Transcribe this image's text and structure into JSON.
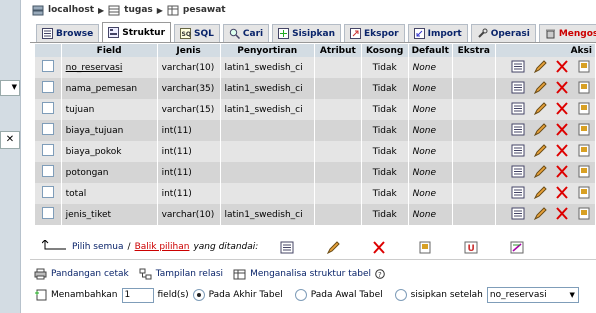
{
  "breadcrumb": {
    "server": "localhost",
    "database": "tugas",
    "table": "pesawat"
  },
  "tabs": [
    {
      "label": "Browse",
      "icon": "browse-icon",
      "active": false
    },
    {
      "label": "Struktur",
      "icon": "structure-icon",
      "active": true
    },
    {
      "label": "SQL",
      "icon": "sql-icon",
      "active": false
    },
    {
      "label": "Cari",
      "icon": "search-icon",
      "active": false
    },
    {
      "label": "Sisipkan",
      "icon": "insert-icon",
      "active": false
    },
    {
      "label": "Ekspor",
      "icon": "export-icon",
      "active": false
    },
    {
      "label": "Import",
      "icon": "import-icon",
      "active": false
    },
    {
      "label": "Operasi",
      "icon": "operations-icon",
      "active": false
    },
    {
      "label": "Mengoso",
      "icon": "empty-icon",
      "active": false
    }
  ],
  "columns": [
    "Field",
    "Jenis",
    "Penyortiran",
    "Atribut",
    "Kosong",
    "Default",
    "Ekstra",
    "Aksi"
  ],
  "rows": [
    {
      "field": "no_reservasi",
      "type": "varchar(10)",
      "collation": "latin1_swedish_ci",
      "attr": "",
      "null": "Tidak",
      "default": "None",
      "extra": "",
      "pk": true
    },
    {
      "field": "nama_pemesan",
      "type": "varchar(35)",
      "collation": "latin1_swedish_ci",
      "attr": "",
      "null": "Tidak",
      "default": "None",
      "extra": "",
      "pk": false
    },
    {
      "field": "tujuan",
      "type": "varchar(15)",
      "collation": "latin1_swedish_ci",
      "attr": "",
      "null": "Tidak",
      "default": "None",
      "extra": "",
      "pk": false
    },
    {
      "field": "biaya_tujuan",
      "type": "int(11)",
      "collation": "",
      "attr": "",
      "null": "Tidak",
      "default": "None",
      "extra": "",
      "pk": false
    },
    {
      "field": "biaya_pokok",
      "type": "int(11)",
      "collation": "",
      "attr": "",
      "null": "Tidak",
      "default": "None",
      "extra": "",
      "pk": false
    },
    {
      "field": "potongan",
      "type": "int(11)",
      "collation": "",
      "attr": "",
      "null": "Tidak",
      "default": "None",
      "extra": "",
      "pk": false
    },
    {
      "field": "total",
      "type": "int(11)",
      "collation": "",
      "attr": "",
      "null": "Tidak",
      "default": "None",
      "extra": "",
      "pk": false
    },
    {
      "field": "jenis_tiket",
      "type": "varchar(10)",
      "collation": "latin1_swedish_ci",
      "attr": "",
      "null": "Tidak",
      "default": "None",
      "extra": "",
      "pk": false
    }
  ],
  "selection": {
    "select_all": "Pilih semua",
    "separator": "/",
    "deselect_all": "Balik pilihan",
    "with_selected": "yang ditandai:"
  },
  "footer": {
    "print_view": "Pandangan cetak",
    "relation_view": "Tampilan relasi",
    "analyze": "Menganalisa struktur tabel",
    "add_label": "Menambahkan",
    "add_count": "1",
    "fields_label": "field(s)",
    "opt_end": "Pada Akhir Tabel",
    "opt_begin": "Pada Awal Tabel",
    "opt_after": "sisipkan setelah",
    "after_field": "no_reservasi"
  },
  "colors": {
    "header_bg": "#d3dce3",
    "row_odd": "#e5e5e5",
    "row_even": "#d5d5d5",
    "link": "#0a246a",
    "delete_red": "#cc0000"
  }
}
